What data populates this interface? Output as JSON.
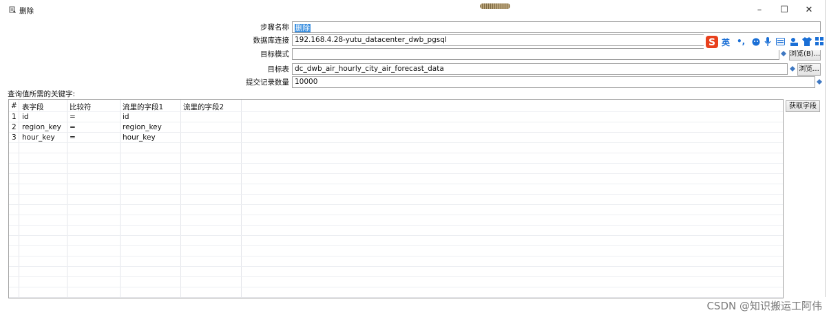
{
  "window": {
    "title": "删除",
    "controls": {
      "minimize": "–",
      "maximize": "☐",
      "close": "✕"
    }
  },
  "form": {
    "step_name": {
      "label": "步骤名称",
      "value": "删除"
    },
    "db_connection": {
      "label": "数据库连接",
      "value": "192.168.4.28-yutu_datacenter_dwb_pgsql"
    },
    "target_schema": {
      "label": "目标模式",
      "value": "",
      "browse": "浏览(B)..."
    },
    "target_table": {
      "label": "目标表",
      "value": "dc_dwb_air_hourly_city_air_forecast_data",
      "browse": "浏览..."
    },
    "commit_size": {
      "label": "提交记录数量",
      "value": "10000"
    }
  },
  "keys_section_label": "查询值所需的关键字:",
  "get_fields_button": "获取字段",
  "table": {
    "columns": [
      "#",
      "表字段",
      "比较符",
      "流里的字段1",
      "流里的字段2"
    ],
    "rows": [
      [
        "1",
        "id",
        "=",
        "id",
        ""
      ],
      [
        "2",
        "region_key",
        "=",
        "region_key",
        ""
      ],
      [
        "3",
        "hour_key",
        "=",
        "hour_key",
        ""
      ]
    ]
  },
  "ime_toolbar": {
    "lang": "英",
    "punct": "•,"
  },
  "watermark": "CSDN @知识搬运工阿伟",
  "colors": {
    "accent": "#3a8fe0",
    "ime": "#1a6fd6",
    "ime_logo": "#e8401c"
  }
}
